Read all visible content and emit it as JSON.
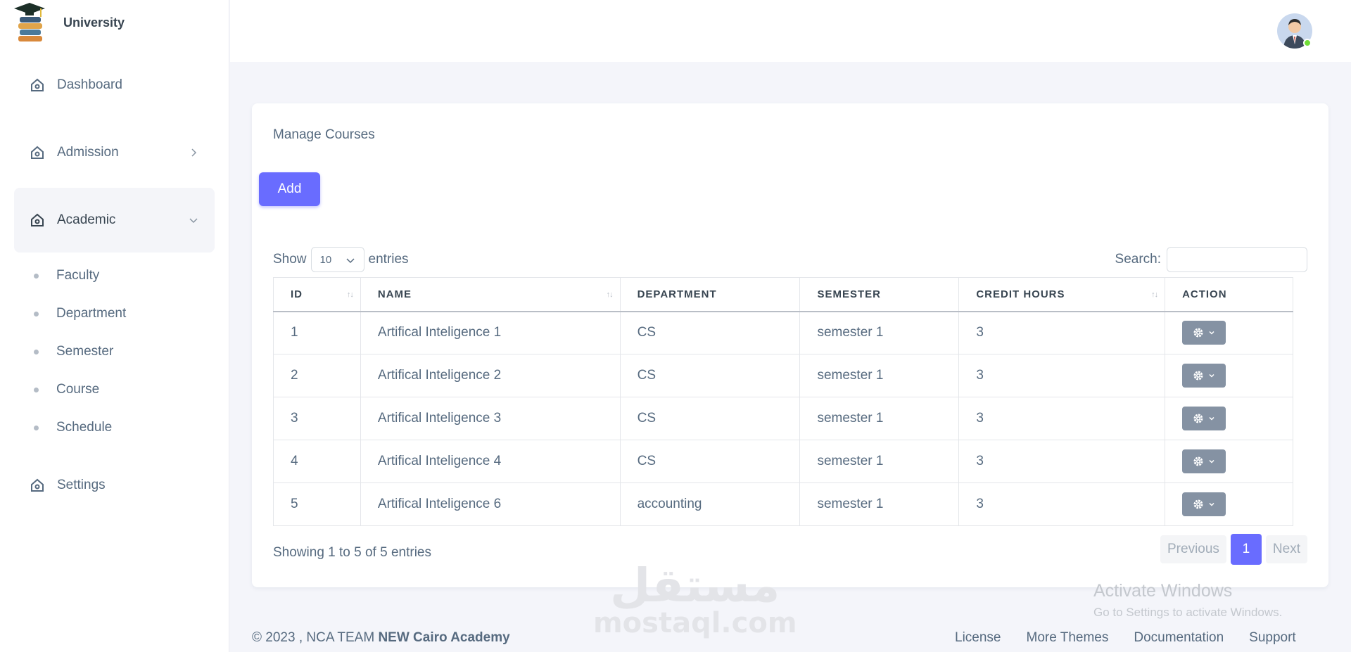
{
  "brand": {
    "name": "University"
  },
  "sidebar": {
    "items": [
      {
        "label": "Dashboard"
      },
      {
        "label": "Admission"
      },
      {
        "label": "Academic"
      },
      {
        "label": "Settings"
      }
    ],
    "academic_sub": [
      {
        "label": "Faculty"
      },
      {
        "label": "Department"
      },
      {
        "label": "Semester"
      },
      {
        "label": "Course"
      },
      {
        "label": "Schedule"
      }
    ]
  },
  "card": {
    "title": "Manage Courses",
    "add_label": "Add",
    "show_label": "Show",
    "entries_value": "10",
    "entries_label": "entries",
    "search_label": "Search:"
  },
  "table": {
    "headers": [
      "ID",
      "NAME",
      "DEPARTMENT",
      "SEMESTER",
      "CREDIT HOURS",
      "ACTION"
    ],
    "rows": [
      {
        "id": "1",
        "name": "Artifical Inteligence 1",
        "department": "CS",
        "semester": "semester 1",
        "credit_hours": "3"
      },
      {
        "id": "2",
        "name": "Artifical Inteligence 2",
        "department": "CS",
        "semester": "semester 1",
        "credit_hours": "3"
      },
      {
        "id": "3",
        "name": "Artifical Inteligence 3",
        "department": "CS",
        "semester": "semester 1",
        "credit_hours": "3"
      },
      {
        "id": "4",
        "name": "Artifical Inteligence 4",
        "department": "CS",
        "semester": "semester 1",
        "credit_hours": "3"
      },
      {
        "id": "5",
        "name": "Artifical Inteligence 6",
        "department": "accounting",
        "semester": "semester 1",
        "credit_hours": "3"
      }
    ]
  },
  "pagination": {
    "info": "Showing 1 to 5 of 5 entries",
    "previous": "Previous",
    "current": "1",
    "next": "Next"
  },
  "footer": {
    "copyright": "© 2023 , NCA TEAM ",
    "org": "NEW Cairo Academy",
    "links": [
      "License",
      "More Themes",
      "Documentation",
      "Support"
    ]
  },
  "overlay": {
    "activate_title": "Activate Windows",
    "activate_sub": "Go to Settings to activate Windows.",
    "watermark_ar": "مستقل",
    "watermark_en": "mostaql.com"
  },
  "colors": {
    "primary": "#696cff",
    "action": "#8592a3",
    "online": "#71dd37"
  }
}
